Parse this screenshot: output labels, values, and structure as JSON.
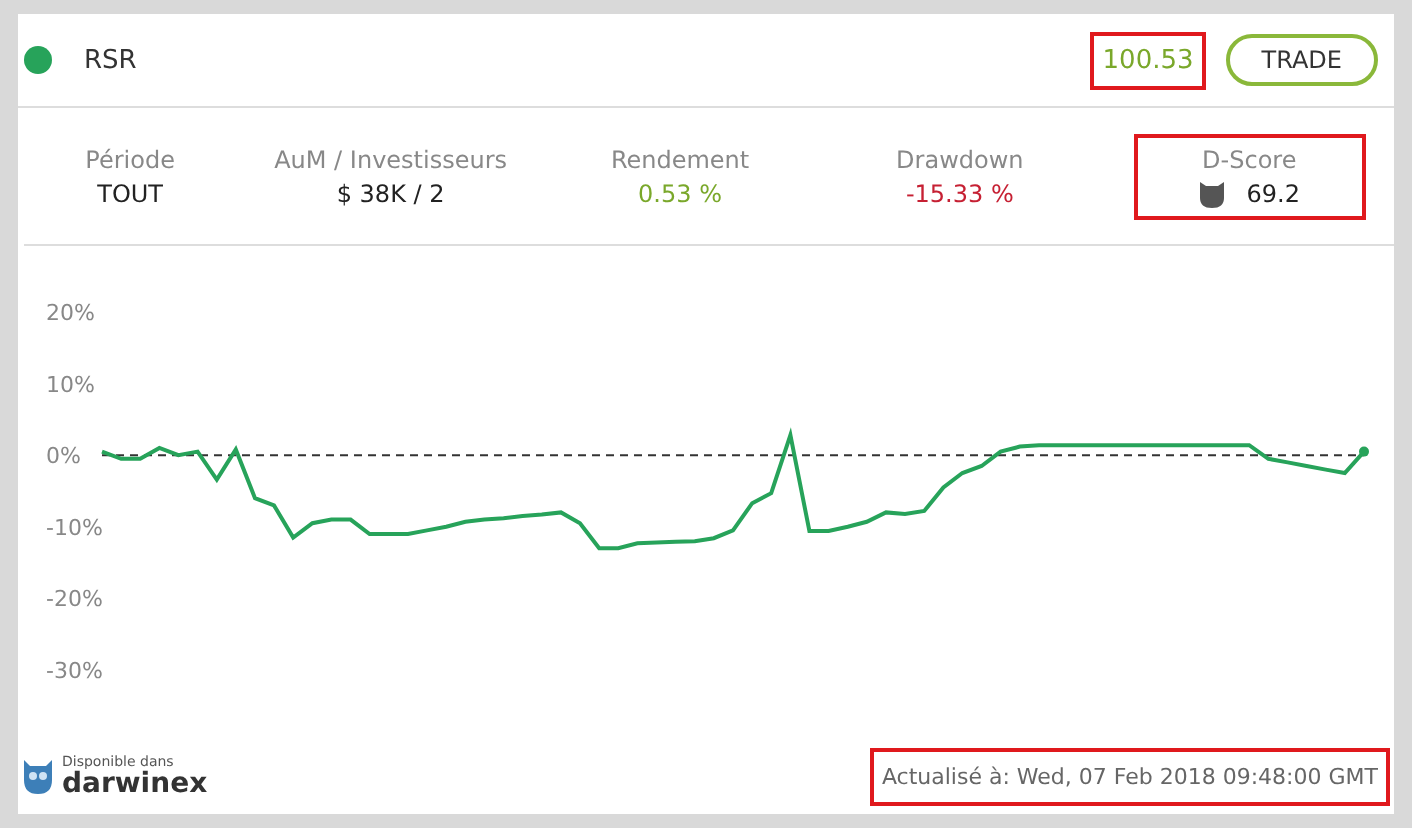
{
  "header": {
    "name": "RSR",
    "price": {
      "text": "100.53",
      "highlighted": true
    },
    "trade_button": "TRADE"
  },
  "stats": [
    {
      "kind": "plain",
      "label": "Période",
      "value": "TOUT",
      "color": "#222222",
      "highlighted": false
    },
    {
      "kind": "plain",
      "label": "AuM / Investisseurs",
      "value": "$ 38K / 2",
      "color": "#222222",
      "highlighted": false
    },
    {
      "kind": "plain",
      "label": "Rendement",
      "value": "0.53 %",
      "color": "#7aa82b",
      "highlighted": false
    },
    {
      "kind": "plain",
      "label": "Drawdown",
      "value": "-15.33 %",
      "color": "#c62033",
      "highlighted": false
    },
    {
      "kind": "score",
      "label": "D-Score",
      "value": "69.2",
      "color": "#222222",
      "highlighted": true
    }
  ],
  "chart": {
    "chart_data": {
      "type": "line",
      "ylim": [
        -30,
        20
      ],
      "yticks": [
        {
          "value": 20,
          "label": "20%"
        },
        {
          "value": 10,
          "label": "10%"
        },
        {
          "value": 0,
          "label": "0%"
        },
        {
          "value": -10,
          "label": "-10%"
        },
        {
          "value": -20,
          "label": "-20%"
        },
        {
          "value": -30,
          "label": "-30%"
        }
      ],
      "categories": [
        null,
        null,
        null,
        null,
        null,
        null,
        null,
        null,
        null,
        null,
        null,
        null,
        null,
        null,
        null,
        null,
        null,
        null,
        null,
        null,
        null,
        null,
        null,
        null,
        null,
        null,
        null,
        null,
        null,
        null,
        null,
        null,
        null,
        null,
        null,
        null,
        null,
        null,
        null,
        null,
        null,
        null,
        null,
        null,
        null,
        null,
        null,
        null,
        null,
        null,
        null,
        null,
        null,
        null,
        null,
        null,
        null,
        null,
        null,
        null,
        null,
        null,
        null,
        null,
        null,
        null,
        null
      ],
      "series": [
        {
          "color": "#27a35a",
          "values": [
            0.5,
            -0.5,
            -0.5,
            1,
            0,
            0.5,
            -3.4,
            0.8,
            -6,
            -7,
            -11.5,
            -9.5,
            -9,
            -9,
            -11,
            -11,
            -11,
            -10.5,
            -10,
            -9.3,
            -9,
            -8.8,
            -8.5,
            -8.3,
            -8,
            -9.5,
            -13,
            -13,
            -12.3,
            -12.2,
            -12.1,
            -12,
            -11.6,
            -10.5,
            -6.7,
            -5.3,
            2.8,
            -10.6,
            -10.6,
            -10,
            -9.3,
            -8,
            -8.2,
            -7.8,
            -4.5,
            -2.5,
            -1.5,
            0.5,
            1.2,
            1.4,
            1.4,
            1.4,
            1.4,
            1.4,
            1.4,
            1.4,
            1.4,
            1.4,
            1.4,
            1.4,
            1.4,
            -0.5,
            -1,
            -1.5,
            -2,
            -2.5,
            0.5
          ]
        }
      ]
    }
  },
  "footer": {
    "brand_caption": "Disponible dans",
    "brand": "darwinex",
    "updated": {
      "text": "Actualisé à: Wed, 07 Feb 2018 09:48:00 GMT",
      "highlighted": true
    }
  }
}
